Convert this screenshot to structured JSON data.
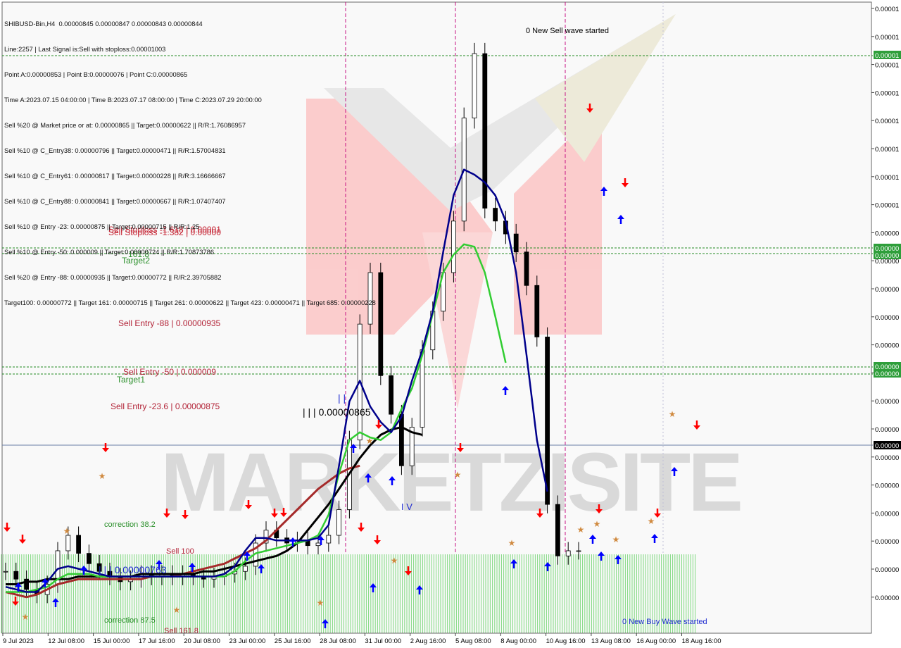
{
  "header": {
    "lines": [
      "SHIBUSD-Bin,H4  0.00000845 0.00000847 0.00000843 0.00000844",
      "Line:2257 | Last Signal is:Sell with stoploss:0.00001003",
      "Point A:0.00000853 | Point B:0.00000076 | Point C:0.00000865",
      "Time A:2023.07.15 04:00:00 | Time B:2023.07.17 08:00:00 | Time C:2023.07.29 20:00:00",
      "Sell %20 @ Market price or at: 0.00000865 || Target:0.00000622 || R/R:1.76086957",
      "Sell %10 @ C_Entry38: 0.00000796 || Target:0.00000471 || R/R:1.57004831",
      "Sell %10 @ C_Entry61: 0.00000817 || Target:0.00000228 || R/R:3.16666667",
      "Sell %10 @ C_Entry88: 0.00000841 || Target:0.00000667 || R/R:1.07407407",
      "Sell %10 @ Entry -23: 0.00000875 || Target:0.00000715 || R/R:1.25",
      "Sell %10 @ Entry -50: 0.000009 || Target:0.00000724 || R/R:1.70873786",
      "Sell %20 @ Entry -88: 0.00000935 || Target:0.00000772 || R/R:2.39705882",
      "Target100: 0.00000772 || Target 161: 0.00000715 || Target 261: 0.00000622 || Target 423: 0.00000471 || Target 685: 0.00000228"
    ]
  },
  "chart_data": {
    "type": "line",
    "symbol": "SHIBUSD-Bin,H4",
    "ohlc_close": [
      8.44e-06,
      8.41e-06,
      8.37e-06,
      8.35e-06,
      8.39e-06,
      8.52e-06,
      8.58e-06,
      8.51e-06,
      8.47e-06,
      8.44e-06,
      8.42e-06,
      8.4e-06,
      8.41e-06,
      8.43e-06,
      8.42e-06,
      8.43e-06,
      8.42e-06,
      8.43e-06,
      8.42e-06,
      8.41e-06,
      8.42e-06,
      8.43e-06,
      8.44e-06,
      8.46e-06,
      8.55e-06,
      8.6e-06,
      8.57e-06,
      8.55e-06,
      8.56e-06,
      8.54e-06,
      8.55e-06,
      8.58e-06,
      8.68e-06,
      8.95e-06,
      9.4e-06,
      9.6e-06,
      9.2e-06,
      9.05e-06,
      8.85e-06,
      9e-06,
      9.3e-06,
      9.45e-06,
      9.6e-06,
      9.8e-06,
      1.02e-05,
      1.045e-05,
      9.85e-06,
      9.8e-06,
      9.75e-06,
      9.68e-06,
      9.55e-06,
      9.35e-06,
      8.7e-06,
      8.5e-06,
      8.52e-06,
      8.52e-06
    ],
    "ema_blue": [
      8.38e-06,
      8.37e-06,
      8.36e-06,
      8.36e-06,
      8.4e-06,
      8.45e-06,
      8.46e-06,
      8.45e-06,
      8.44e-06,
      8.43e-06,
      8.42e-06,
      8.42e-06,
      8.42e-06,
      8.42e-06,
      8.42e-06,
      8.42e-06,
      8.42e-06,
      8.42e-06,
      8.42e-06,
      8.42e-06,
      8.42e-06,
      8.43e-06,
      8.46e-06,
      8.52e-06,
      8.57e-06,
      8.57e-06,
      8.56e-06,
      8.56e-06,
      8.56e-06,
      8.56e-06,
      8.57e-06,
      8.62e-06,
      8.85e-06,
      9.1e-06,
      9.18e-06,
      9.08e-06,
      9.02e-06,
      8.98e-06,
      9.04e-06,
      9.18e-06,
      9.3e-06,
      9.45e-06,
      9.68e-06,
      9.9e-06,
      1e-05,
      9.98e-06,
      9.95e-06,
      9.9e-06,
      9.8e-06,
      9.6e-06,
      9.28e-06,
      8.95e-06,
      8.75e-06
    ],
    "ema_green": [
      8.36e-06,
      8.36e-06,
      8.36e-06,
      8.37e-06,
      8.38e-06,
      8.41e-06,
      8.43e-06,
      8.43e-06,
      8.43e-06,
      8.42e-06,
      8.42e-06,
      8.42e-06,
      8.42e-06,
      8.42e-06,
      8.42e-06,
      8.42e-06,
      8.42e-06,
      8.42e-06,
      8.42e-06,
      8.42e-06,
      8.42e-06,
      8.42e-06,
      8.44e-06,
      8.48e-06,
      8.51e-06,
      8.52e-06,
      8.53e-06,
      8.54e-06,
      8.55e-06,
      8.56e-06,
      8.58e-06,
      8.66e-06,
      8.82e-06,
      8.95e-06,
      8.98e-06,
      8.96e-06,
      8.95e-06,
      8.98e-06,
      9.07e-06,
      9.15e-06,
      9.28e-06,
      9.44e-06,
      9.6e-06,
      9.67e-06,
      9.71e-06,
      9.7e-06,
      9.6e-06,
      9.43e-06,
      9.25e-06
    ],
    "ma_black": [
      8.39e-06,
      8.39e-06,
      8.4e-06,
      8.4e-06,
      8.41e-06,
      8.41e-06,
      8.41e-06,
      8.42e-06,
      8.42e-06,
      8.42e-06,
      8.42e-06,
      8.42e-06,
      8.42e-06,
      8.43e-06,
      8.43e-06,
      8.43e-06,
      8.43e-06,
      8.43e-06,
      8.43e-06,
      8.44e-06,
      8.44e-06,
      8.45e-06,
      8.46e-06,
      8.47e-06,
      8.48e-06,
      8.49e-06,
      8.5e-06,
      8.52e-06,
      8.55e-06,
      8.6e-06,
      8.65e-06,
      8.7e-06,
      8.76e-06,
      8.82e-06,
      8.88e-06,
      8.93e-06,
      8.97e-06,
      8.99e-06,
      9e-06,
      8.98e-06,
      8.97e-06
    ],
    "ma_darkred": [
      8.36e-06,
      8.35e-06,
      8.34e-06,
      8.35e-06,
      8.37e-06,
      8.39e-06,
      8.4e-06,
      8.41e-06,
      8.41e-06,
      8.41e-06,
      8.41e-06,
      8.41e-06,
      8.41e-06,
      8.41e-06,
      8.42e-06,
      8.42e-06,
      8.42e-06,
      8.43e-06,
      8.44e-06,
      8.45e-06,
      8.46e-06,
      8.47e-06,
      8.49e-06,
      8.51e-06,
      8.53e-06,
      8.56e-06,
      8.6e-06,
      8.64e-06,
      8.68e-06,
      8.72e-06,
      8.76e-06,
      8.79e-06,
      8.82e-06,
      8.84e-06,
      8.85e-06
    ],
    "x_labels": [
      "9 Jul 2023",
      "12 Jul 08:00",
      "15 Jul 00:00",
      "17 Jul 16:00",
      "20 Jul 08:00",
      "23 Jul 00:00",
      "25 Jul 16:00",
      "28 Jul 08:00",
      "31 Jul 00:00",
      "2 Aug 16:00",
      "5 Aug 08:00",
      "8 Aug 00:00",
      "10 Aug 16:00",
      "13 Aug 08:00",
      "16 Aug 00:00",
      "18 Aug 16:00"
    ],
    "y_labels": [
      "0.00001",
      "0.00001",
      "0.00001",
      "0.00001",
      "0.00001",
      "0.00001",
      "0.00001",
      "0.00001",
      "0.00000",
      "0.00000",
      "0.00000",
      "0.00000",
      "0.00000",
      "0.00000",
      "0.00000",
      "0.00000",
      "0.00000",
      "0.00000",
      "0.00000",
      "0.00000",
      "0.00000",
      "0.00000"
    ],
    "price_tags": [
      {
        "label": "0.00001",
        "color": "#2e9e3a"
      },
      {
        "label": "0.00000",
        "color": "#2e9e3a"
      },
      {
        "label": "0.00000",
        "color": "#2e9e3a"
      },
      {
        "label": "0.00000",
        "color": "#2e9e3a"
      },
      {
        "label": "0.00000",
        "color": "#2e9e3a"
      },
      {
        "label": "0.00000",
        "color": "#000000"
      }
    ],
    "annotations": {
      "sell_wave": "0 New Sell wave started",
      "buy_wave": "0 New Buy Wave started",
      "sl1": "Sell Stoploss -1.618 | 0.00001",
      "sl2": "Sell Stoploss -1.382 | 0.00000",
      "fib": "161.8",
      "target2": "Target2",
      "entry88": "Sell Entry -88 | 0.00000935",
      "entry50": "Sell Entry -50 | 0.000009",
      "target1": "Target1",
      "entry23": "Sell Entry -23.6 | 0.00000875",
      "point_c": "| | | 0.00000865",
      "point_b": "| | | 0.00000763",
      "sell100": "Sell 100",
      "sell161": "Sell 161.8",
      "corr382": "correction 38.2",
      "corr875": "correction 87.5",
      "pipes_top": "| |",
      "iv": "I V"
    },
    "colors": {
      "ema_blue": "#00008b",
      "ema_green": "#32cd32",
      "ma_black": "#000000",
      "ma_darkred": "#a52a2a",
      "sell_arrow": "#ff0000",
      "buy_arrow": "#0000ff",
      "green_level": "#228b22",
      "magenta_line": "#c71585"
    },
    "watermark": "MARKETZISITE"
  }
}
